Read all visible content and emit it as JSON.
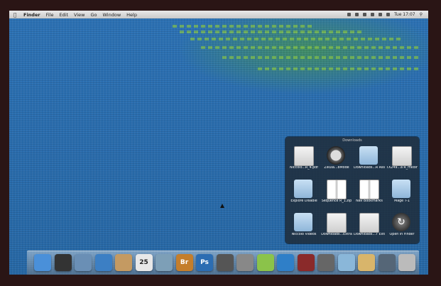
{
  "menubar": {
    "apple_icon": "apple-icon",
    "app": "Finder",
    "menus": [
      "File",
      "Edit",
      "View",
      "Go",
      "Window",
      "Help"
    ],
    "clock": "Tue 17:07"
  },
  "stack": {
    "title": "Downloads",
    "items": [
      {
        "label": "Niccolo...R_4.pdf",
        "icon": "doc"
      },
      {
        "label": "Zikula...8Mode",
        "icon": "clock"
      },
      {
        "label": "Downloads...R Assets",
        "icon": "folder"
      },
      {
        "label": "TX249...a R_mkdir",
        "icon": "doc"
      },
      {
        "label": "Explore Disable",
        "icon": "folder"
      },
      {
        "label": "Sequence R_1.zip",
        "icon": "zip"
      },
      {
        "label": "Nav Bookmarks",
        "icon": "zip"
      },
      {
        "label": "Mage T-1",
        "icon": "folder"
      },
      {
        "label": "Niccolo Videos",
        "icon": "folder"
      },
      {
        "label": "Downloads...Extra",
        "icon": "doc"
      },
      {
        "label": "Downloads...7 Extras",
        "icon": "doc"
      },
      {
        "label": "Open in Finder",
        "icon": "finder"
      }
    ]
  },
  "dock": [
    {
      "name": "finder-icon",
      "color": "#4a90d9",
      "glyph": ""
    },
    {
      "name": "dashboard-icon",
      "color": "#333",
      "glyph": ""
    },
    {
      "name": "preview-icon",
      "color": "#6a8fb5",
      "glyph": ""
    },
    {
      "name": "safari-icon",
      "color": "#3c7fc4",
      "glyph": ""
    },
    {
      "name": "address-book-icon",
      "color": "#c49a62",
      "glyph": ""
    },
    {
      "name": "ical-icon",
      "color": "#e8e8e8",
      "glyph": "25"
    },
    {
      "name": "photos-icon",
      "color": "#7d9fb7",
      "glyph": ""
    },
    {
      "name": "bridge-icon",
      "color": "#c47e2c",
      "glyph": "Br"
    },
    {
      "name": "photoshop-icon",
      "color": "#2c6db2",
      "glyph": "Ps"
    },
    {
      "name": "utility-icon",
      "color": "#555",
      "glyph": ""
    },
    {
      "name": "app-icon",
      "color": "#888",
      "glyph": ""
    },
    {
      "name": "spotify-icon",
      "color": "#8bc34a",
      "glyph": ""
    },
    {
      "name": "itunes-icon",
      "color": "#2f7fc8",
      "glyph": ""
    },
    {
      "name": "photo-booth-icon",
      "color": "#8a2a2a",
      "glyph": ""
    },
    {
      "name": "app-2-icon",
      "color": "#666",
      "glyph": ""
    },
    {
      "name": "downloads-folder-icon",
      "color": "#8ab7d9",
      "glyph": ""
    },
    {
      "name": "documents-folder-icon",
      "color": "#d8b56b",
      "glyph": ""
    },
    {
      "name": "stack-icon",
      "color": "#567",
      "glyph": ""
    },
    {
      "name": "trash-icon",
      "color": "#bbb",
      "glyph": ""
    }
  ]
}
